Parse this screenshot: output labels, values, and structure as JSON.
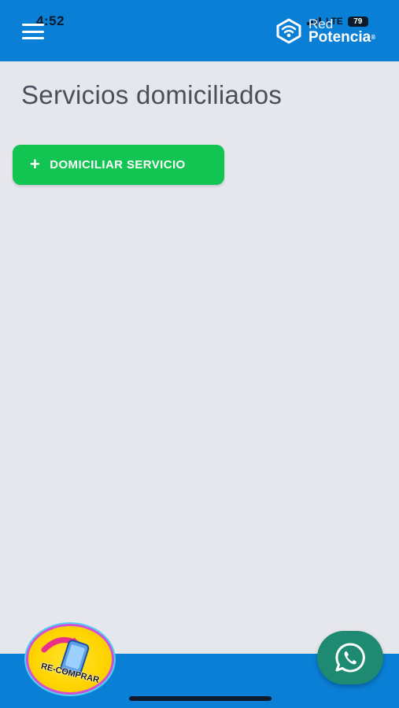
{
  "status_bar": {
    "time": "4:52",
    "network": "LTE",
    "battery": "79"
  },
  "header": {
    "menu_icon": "hamburger-menu-icon",
    "brand_line1": "Red",
    "brand_line2": "Potencia",
    "brand_reg": "®",
    "brand_icon": "red-potencia-logo-icon"
  },
  "main": {
    "title": "Servicios domiciliados",
    "add_button": {
      "icon": "plus-icon",
      "label": "DOMICILIAR SERVICIO"
    }
  },
  "floating": {
    "recomprar_label": "RE-COMPRAR",
    "recomprar_icon": "phone-recompra-icon",
    "whatsapp_icon": "whatsapp-icon"
  },
  "colors": {
    "header_bg": "#0a7fd6",
    "page_bg": "#e6e7ec",
    "primary_button": "#12c552",
    "whatsapp_button": "#1f8a72",
    "title_text": "#4a4f5c"
  }
}
